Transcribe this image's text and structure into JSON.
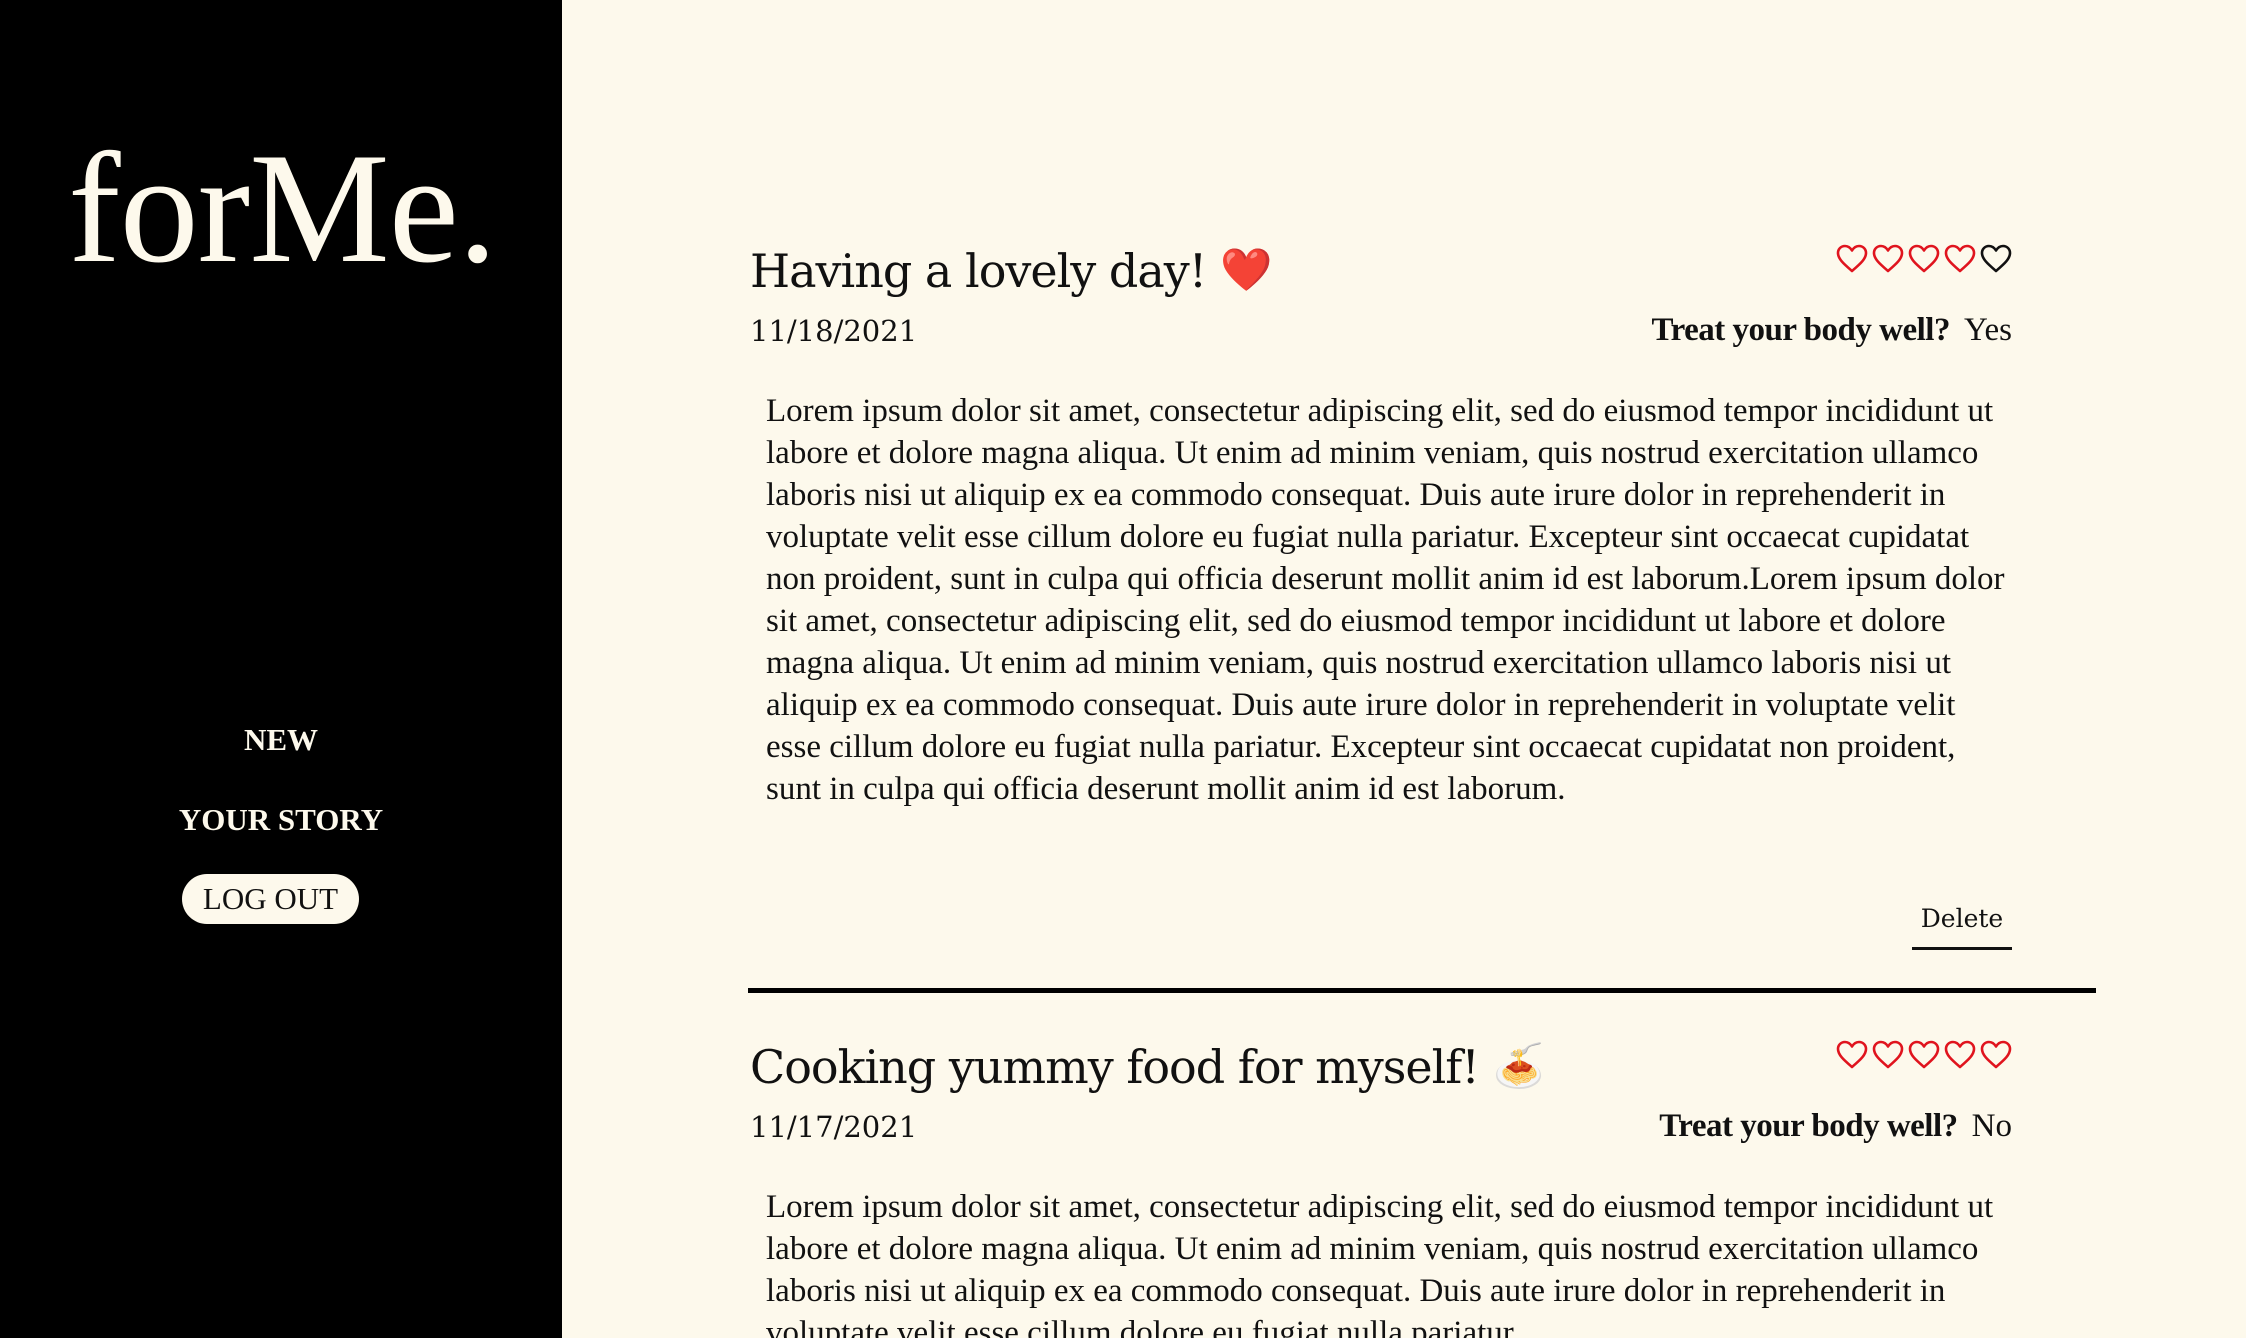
{
  "app": {
    "logo": "forMe."
  },
  "nav": {
    "new_label": "NEW",
    "story_label": "YOUR STORY",
    "logout_label": "LOG OUT"
  },
  "colors": {
    "sidebar_bg": "#000000",
    "page_bg": "#fdf9ec",
    "heart_filled": "#e0141e",
    "heart_empty": "#111111"
  },
  "entries": [
    {
      "title": "Having a lovely day!",
      "emoji": "❤️",
      "date": "11/18/2021",
      "rating": 4,
      "rating_max": 5,
      "treat_label": "Treat your body well?",
      "treat_value": "Yes",
      "body": "Lorem ipsum dolor sit amet, consectetur adipiscing elit, sed do eiusmod tempor incididunt ut labore et dolore magna aliqua. Ut enim ad minim veniam, quis nostrud exercitation ullamco laboris nisi ut aliquip ex ea commodo consequat. Duis aute irure dolor in reprehenderit in voluptate velit esse cillum dolore eu fugiat nulla pariatur. Excepteur sint occaecat cupidatat non proident, sunt in culpa qui officia deserunt mollit anim id est laborum.Lorem ipsum dolor sit amet, consectetur adipiscing elit, sed do eiusmod tempor incididunt ut labore et dolore magna aliqua. Ut enim ad minim veniam, quis nostrud exercitation ullamco laboris nisi ut aliquip ex ea commodo consequat. Duis aute irure dolor in reprehenderit in voluptate velit esse cillum dolore eu fugiat nulla pariatur. Excepteur sint occaecat cupidatat non proident, sunt in culpa qui officia deserunt mollit anim id est laborum.",
      "delete_label": "Delete"
    },
    {
      "title": "Cooking yummy food for myself!",
      "emoji": "🍝",
      "date": "11/17/2021",
      "rating": 5,
      "rating_max": 5,
      "treat_label": "Treat your body well?",
      "treat_value": "No",
      "body": "Lorem ipsum dolor sit amet, consectetur adipiscing elit, sed do eiusmod tempor incididunt ut labore et dolore magna aliqua. Ut enim ad minim veniam, quis nostrud exercitation ullamco laboris nisi ut aliquip ex ea commodo consequat. Duis aute irure dolor in reprehenderit in voluptate velit esse cillum dolore eu fugiat nulla pariatur."
    }
  ]
}
